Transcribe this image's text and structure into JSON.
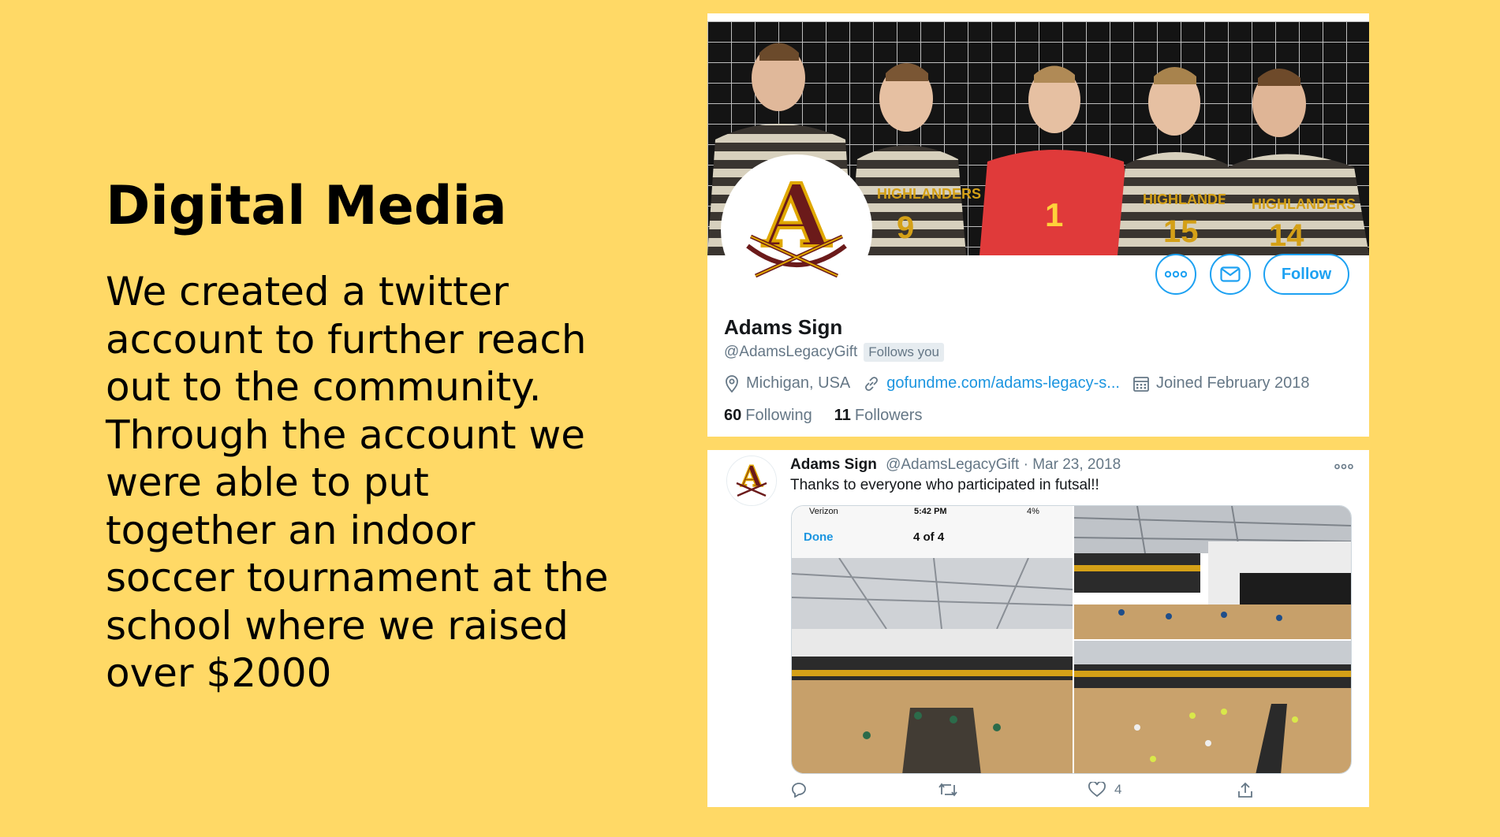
{
  "slide": {
    "title": "Digital Media",
    "body": "We created a twitter account to further reach out to the community. Through the account we were able to put together an indoor soccer tournament at the school where we raised over $2000"
  },
  "profile": {
    "avatar_letter": "A",
    "display_name": "Adams Sign",
    "handle": "@AdamsLegacyGift",
    "follows_you": "Follows you",
    "location": "Michigan, USA",
    "link": "gofundme.com/adams-legacy-s...",
    "joined": "Joined February 2018",
    "following_count": "60",
    "following_label": "Following",
    "followers_count": "11",
    "followers_label": "Followers",
    "follow_button": "Follow",
    "accent_color": "#1DA1F2",
    "icons": [
      "more-icon",
      "message-icon",
      "location-icon",
      "link-icon",
      "calendar-icon"
    ]
  },
  "tweet": {
    "name": "Adams Sign",
    "handle": "@AdamsLegacyGift",
    "separator": "·",
    "date": "Mar 23, 2018",
    "text": "Thanks to everyone who participated in futsal!!",
    "like_count": "4",
    "phone": {
      "carrier": "Verizon",
      "time": "5:42 PM",
      "battery": "4%",
      "done": "Done",
      "counter": "4 of 4"
    },
    "icons": [
      "reply-icon",
      "retweet-icon",
      "like-icon",
      "share-icon",
      "more-icon"
    ]
  },
  "banner": {
    "jersey_numbers": [
      "9",
      "1",
      "15",
      "14"
    ],
    "jersey_text": [
      "HIGHLANDERS",
      "HIGHLANDERS",
      "HIGHLANDERS",
      "HIGHLANDERS"
    ]
  }
}
